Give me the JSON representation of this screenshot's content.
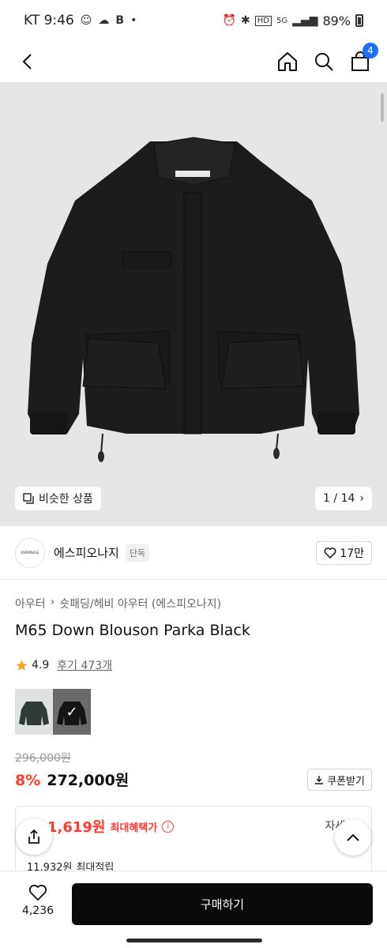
{
  "status_bar": {
    "carrier_time": "KT 9:46",
    "battery": "89%",
    "icons": [
      "face-icon",
      "cloud-icon",
      "b-icon",
      "dot-icon",
      "alarm-icon",
      "bluetooth-icon",
      "hd-icon",
      "5g-icon",
      "signal-icon",
      "battery-icon"
    ]
  },
  "header": {
    "cart_count": "4",
    "icons": [
      "back-arrow-icon",
      "home-icon",
      "search-icon",
      "shopping-bag-icon"
    ]
  },
  "hero": {
    "similar_label": "비슷한 상품",
    "counter": "1 / 14"
  },
  "brand": {
    "logo_text": "ESPIONAGE",
    "name": "에스피오나지",
    "tag": "단독",
    "likes": "17만"
  },
  "product": {
    "breadcrumb": [
      "아우터",
      "숏패딩/헤비 아우터 (에스피오나지)"
    ],
    "title": "M65 Down Blouson Parka Black",
    "rating": "4.9",
    "reviews": "후기 473개",
    "original_price": "296,000원",
    "discount": "8%",
    "price": "272,000원",
    "coupon_label": "쿠폰받기"
  },
  "benefit": {
    "price": "1,619원",
    "label": "최대혜택가",
    "detail": "자세히",
    "points_amount": "11,932원",
    "points_label": "최대적립"
  },
  "bottom_bar": {
    "like_count": "4,236",
    "buy_label": "구매하기"
  },
  "colors": {
    "accent_red": "#ff3b30",
    "badge_blue": "#1f6fff",
    "buy_button": "#0a0a0a"
  }
}
